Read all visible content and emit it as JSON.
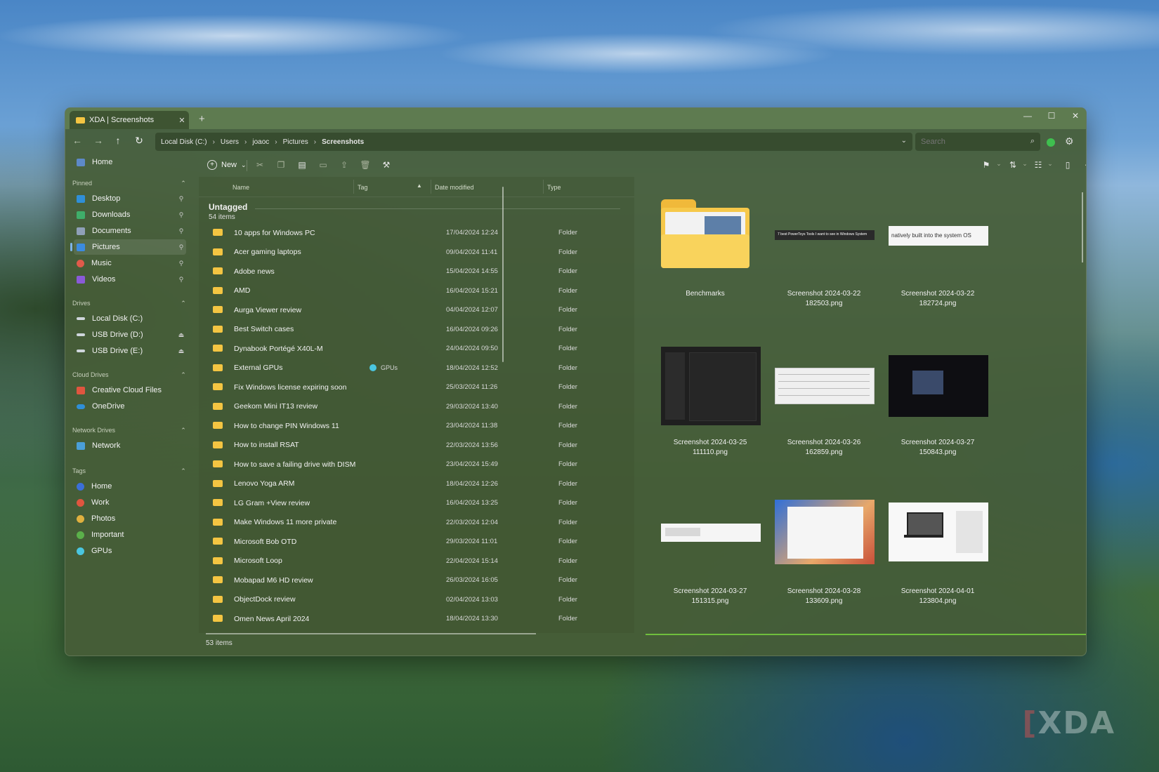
{
  "window": {
    "tab_title": "XDA | Screenshots",
    "tab_close": "✕",
    "new_tab": "+",
    "minimize": "—",
    "maximize": "☐",
    "close": "✕"
  },
  "address": {
    "crumbs": [
      "Local Disk (C:)",
      "Users",
      "joaoc",
      "Pictures",
      "Screenshots"
    ],
    "separator": "›"
  },
  "search": {
    "placeholder": "Search"
  },
  "sidebar": {
    "home": "Home",
    "sections": {
      "pinned": "Pinned",
      "drives": "Drives",
      "cloud": "Cloud Drives",
      "network": "Network Drives",
      "tags": "Tags"
    },
    "pinned": [
      {
        "label": "Desktop",
        "color": "#2f8fd8"
      },
      {
        "label": "Downloads",
        "color": "#3fae6a"
      },
      {
        "label": "Documents",
        "color": "#8fa0b8"
      },
      {
        "label": "Pictures",
        "color": "#3b8be0"
      },
      {
        "label": "Music",
        "color": "#e05a4a"
      },
      {
        "label": "Videos",
        "color": "#8a5ad8"
      }
    ],
    "drives": [
      {
        "label": "Local Disk (C:)"
      },
      {
        "label": "USB Drive (D:)"
      },
      {
        "label": "USB Drive (E:)"
      }
    ],
    "cloud": [
      {
        "label": "Creative Cloud Files",
        "color": "#e0553f"
      },
      {
        "label": "OneDrive",
        "color": "#2f8fd8"
      }
    ],
    "network": [
      {
        "label": "Network"
      }
    ],
    "tags": [
      {
        "label": "Home",
        "color": "#3b6fd8"
      },
      {
        "label": "Work",
        "color": "#e0553f"
      },
      {
        "label": "Photos",
        "color": "#e0b03f"
      },
      {
        "label": "Important",
        "color": "#5bb04a"
      },
      {
        "label": "GPUs",
        "color": "#4ac6e0"
      }
    ]
  },
  "toolbar": {
    "new_label": "New",
    "new_icon": "+"
  },
  "columns": {
    "name": "Name",
    "tag": "Tag",
    "date": "Date modified",
    "type": "Type",
    "sort_indicator": "▲"
  },
  "group": {
    "title": "Untagged",
    "count": "54 items"
  },
  "files": [
    {
      "name": "10 apps for Windows PC",
      "tag": "",
      "date": "17/04/2024 12:24",
      "type": "Folder"
    },
    {
      "name": "Acer gaming laptops",
      "tag": "",
      "date": "09/04/2024 11:41",
      "type": "Folder"
    },
    {
      "name": "Adobe news",
      "tag": "",
      "date": "15/04/2024 14:55",
      "type": "Folder"
    },
    {
      "name": "AMD",
      "tag": "",
      "date": "16/04/2024 15:21",
      "type": "Folder"
    },
    {
      "name": "Aurga Viewer review",
      "tag": "",
      "date": "04/04/2024 12:07",
      "type": "Folder"
    },
    {
      "name": "Best Switch cases",
      "tag": "",
      "date": "16/04/2024 09:26",
      "type": "Folder"
    },
    {
      "name": "Dynabook Portégé X40L-M",
      "tag": "",
      "date": "24/04/2024 09:50",
      "type": "Folder"
    },
    {
      "name": "External GPUs",
      "tag": "GPUs",
      "date": "18/04/2024 12:52",
      "type": "Folder"
    },
    {
      "name": "Fix Windows license expiring soon",
      "tag": "",
      "date": "25/03/2024 11:26",
      "type": "Folder"
    },
    {
      "name": "Geekom Mini IT13 review",
      "tag": "",
      "date": "29/03/2024 13:40",
      "type": "Folder"
    },
    {
      "name": "How to change PIN Windows 11",
      "tag": "",
      "date": "23/04/2024 11:38",
      "type": "Folder"
    },
    {
      "name": "How to install RSAT",
      "tag": "",
      "date": "22/03/2024 13:56",
      "type": "Folder"
    },
    {
      "name": "How to save a failing drive with DISM",
      "tag": "",
      "date": "23/04/2024 15:49",
      "type": "Folder"
    },
    {
      "name": "Lenovo Yoga ARM",
      "tag": "",
      "date": "18/04/2024 12:26",
      "type": "Folder"
    },
    {
      "name": "LG Gram +View review",
      "tag": "",
      "date": "16/04/2024 13:25",
      "type": "Folder"
    },
    {
      "name": "Make Windows 11 more private",
      "tag": "",
      "date": "22/03/2024 12:04",
      "type": "Folder"
    },
    {
      "name": "Microsoft Bob OTD",
      "tag": "",
      "date": "29/03/2024 11:01",
      "type": "Folder"
    },
    {
      "name": "Microsoft Loop",
      "tag": "",
      "date": "22/04/2024 15:14",
      "type": "Folder"
    },
    {
      "name": "Mobapad M6 HD review",
      "tag": "",
      "date": "26/03/2024 16:05",
      "type": "Folder"
    },
    {
      "name": "ObjectDock review",
      "tag": "",
      "date": "02/04/2024 13:03",
      "type": "Folder"
    },
    {
      "name": "Omen News April 2024",
      "tag": "",
      "date": "18/04/2024 13:30",
      "type": "Folder"
    }
  ],
  "tag_colors": {
    "GPUs": "#4ac6e0"
  },
  "gallery": [
    {
      "l1": "Benchmarks",
      "l2": ""
    },
    {
      "l1": "Screenshot 2024-03-22",
      "l2": "182503.png",
      "thumb_text": "7 best PowerToys Tools I want to see in Windows System"
    },
    {
      "l1": "Screenshot 2024-03-22",
      "l2": "182724.png",
      "thumb_text": "natively built into the system OS"
    },
    {
      "l1": "Screenshot 2024-03-25",
      "l2": "111110.png"
    },
    {
      "l1": "Screenshot 2024-03-26",
      "l2": "162859.png"
    },
    {
      "l1": "Screenshot 2024-03-27",
      "l2": "150843.png"
    },
    {
      "l1": "Screenshot 2024-03-27",
      "l2": "151315.png"
    },
    {
      "l1": "Screenshot 2024-03-28",
      "l2": "133609.png"
    },
    {
      "l1": "Screenshot 2024-04-01",
      "l2": "123804.png"
    }
  ],
  "status": {
    "items": "53 items"
  },
  "watermark": {
    "text": "XDA"
  }
}
